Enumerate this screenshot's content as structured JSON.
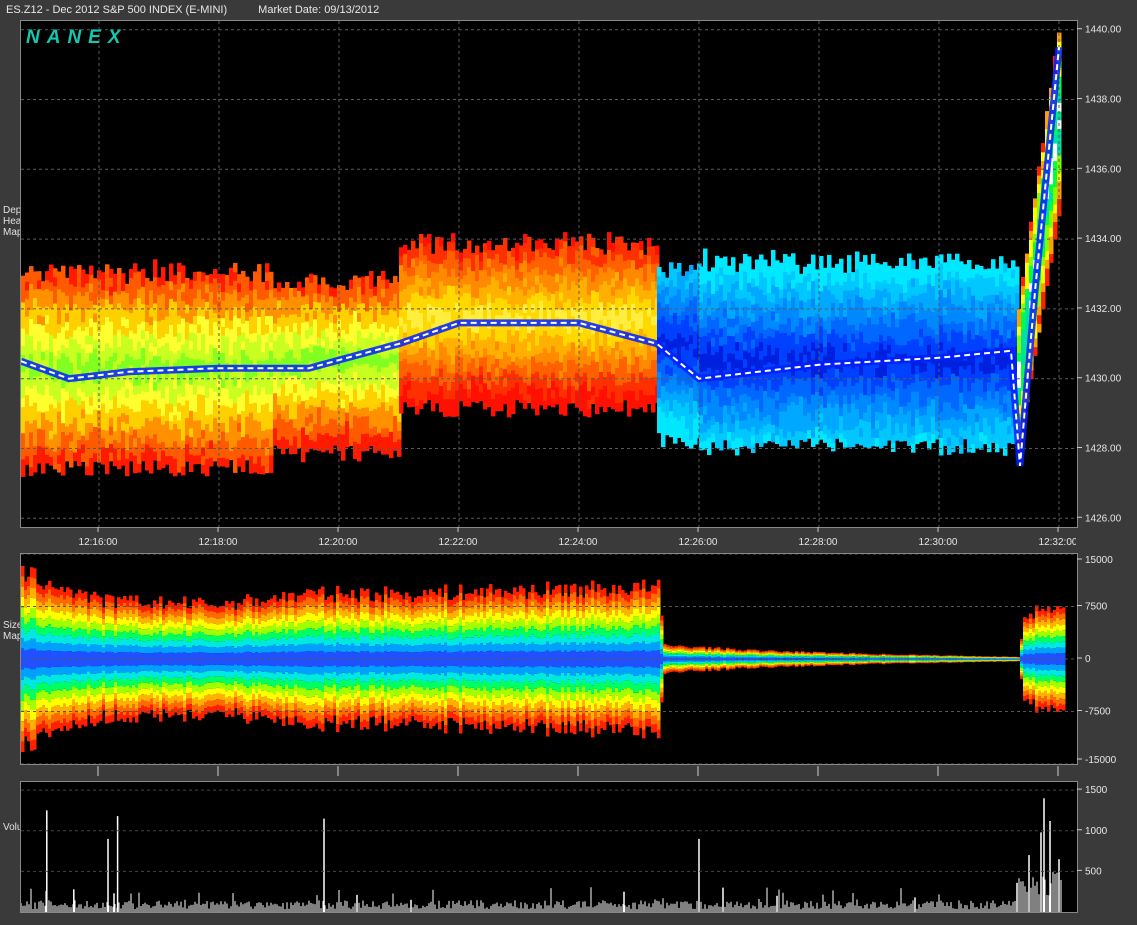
{
  "header": {
    "symbol": "ES.Z12 - Dec 2012 S&P 500 INDEX (E-MINI)",
    "market_date": "Market Date: 09/13/2012"
  },
  "logo": "NANEX",
  "panel_labels": {
    "heat": "Depth\nHeat\nMap",
    "size": "Size\nMap",
    "volume": "Volume"
  },
  "colors": {
    "background": "#000000",
    "frame": "#3a3a3a",
    "grid": "#555555",
    "heat_scale": [
      "#ff1a00",
      "#ff7a00",
      "#ffff00",
      "#00ff40",
      "#00e0e0",
      "#0050ff",
      "#0000cc"
    ]
  },
  "chart_data": [
    {
      "type": "heatmap",
      "title": "Depth Heat Map",
      "x_ticks": [
        "12:16:00",
        "12:18:00",
        "12:20:00",
        "12:22:00",
        "12:24:00",
        "12:26:00",
        "12:28:00",
        "12:30:00",
        "12:32:00"
      ],
      "y_ticks": [
        "1426.00",
        "1428.00",
        "1430.00",
        "1432.00",
        "1434.00",
        "1436.00",
        "1438.00",
        "1440.00"
      ],
      "ylim": [
        1425.75,
        1440.25
      ],
      "xlim_minutes": [
        14.7,
        32.3
      ],
      "grid": true,
      "segments": [
        {
          "t0": 14.7,
          "t1": 18.9,
          "low": 1427.2,
          "high": 1433.2,
          "center": 1430.2,
          "palette": "warm"
        },
        {
          "t0": 18.9,
          "t1": 21.0,
          "low": 1427.6,
          "high": 1432.9,
          "center": 1430.4,
          "palette": "warm"
        },
        {
          "t0": 21.0,
          "t1": 25.3,
          "low": 1428.9,
          "high": 1434.0,
          "center": 1431.6,
          "palette": "hot"
        },
        {
          "t0": 25.3,
          "t1": 26.0,
          "low": 1428.0,
          "high": 1433.3,
          "center": 1430.9,
          "palette": "cool"
        },
        {
          "t0": 26.0,
          "t1": 31.3,
          "low": 1427.8,
          "high": 1433.5,
          "center": 1430.4,
          "palette": "cool"
        },
        {
          "t0": 31.3,
          "t1": 32.0,
          "low": 1428.0,
          "high": 1440.0,
          "center": 1436.0,
          "palette": "rally"
        }
      ],
      "trade_line": [
        {
          "t": 14.7,
          "price": 1430.5
        },
        {
          "t": 15.5,
          "price": 1430.0
        },
        {
          "t": 16.5,
          "price": 1430.2
        },
        {
          "t": 18.0,
          "price": 1430.3
        },
        {
          "t": 19.5,
          "price": 1430.3
        },
        {
          "t": 21.0,
          "price": 1431.0
        },
        {
          "t": 22.0,
          "price": 1431.6
        },
        {
          "t": 24.0,
          "price": 1431.6
        },
        {
          "t": 25.3,
          "price": 1431.0
        },
        {
          "t": 26.0,
          "price": 1430.0
        },
        {
          "t": 28.0,
          "price": 1430.4
        },
        {
          "t": 30.0,
          "price": 1430.6
        },
        {
          "t": 31.2,
          "price": 1430.8
        },
        {
          "t": 31.35,
          "price": 1427.5
        },
        {
          "t": 31.6,
          "price": 1432.5
        },
        {
          "t": 32.0,
          "price": 1439.5
        }
      ]
    },
    {
      "type": "area",
      "title": "Size Map",
      "y_ticks": [
        "15000",
        "7500",
        "0",
        "-7500",
        "-15000"
      ],
      "ylim": [
        -15000,
        15000
      ],
      "envelope": [
        {
          "t": 14.7,
          "max": 12500
        },
        {
          "t": 16.0,
          "max": 8500
        },
        {
          "t": 18.0,
          "max": 8000
        },
        {
          "t": 19.5,
          "max": 9500
        },
        {
          "t": 21.0,
          "max": 9500
        },
        {
          "t": 23.0,
          "max": 10000
        },
        {
          "t": 25.3,
          "max": 10500
        },
        {
          "t": 25.4,
          "max": 2000
        },
        {
          "t": 27.0,
          "max": 1200
        },
        {
          "t": 29.0,
          "max": 700
        },
        {
          "t": 31.0,
          "max": 350
        },
        {
          "t": 31.3,
          "max": 300
        },
        {
          "t": 31.4,
          "max": 6000
        },
        {
          "t": 31.8,
          "max": 8000
        },
        {
          "t": 32.0,
          "max": 7000
        }
      ]
    },
    {
      "type": "bar",
      "title": "Volume",
      "y_ticks": [
        "1500",
        "1000",
        "500"
      ],
      "ylim": [
        0,
        1600
      ],
      "spikes": [
        {
          "t": 15.12,
          "v": 260
        },
        {
          "t": 15.13,
          "v": 1250
        },
        {
          "t": 15.58,
          "v": 280
        },
        {
          "t": 16.15,
          "v": 900
        },
        {
          "t": 16.31,
          "v": 1180
        },
        {
          "t": 16.25,
          "v": 230
        },
        {
          "t": 19.75,
          "v": 1150
        },
        {
          "t": 20.3,
          "v": 210
        },
        {
          "t": 21.2,
          "v": 150
        },
        {
          "t": 24.75,
          "v": 250
        },
        {
          "t": 26.0,
          "v": 900
        },
        {
          "t": 26.4,
          "v": 300
        },
        {
          "t": 27.3,
          "v": 200
        },
        {
          "t": 29.6,
          "v": 180
        },
        {
          "t": 31.3,
          "v": 360
        },
        {
          "t": 31.5,
          "v": 700
        },
        {
          "t": 31.7,
          "v": 980
        },
        {
          "t": 31.75,
          "v": 1400
        },
        {
          "t": 31.85,
          "v": 1120
        },
        {
          "t": 32.0,
          "v": 650
        }
      ],
      "baseline_volume": 120
    }
  ]
}
